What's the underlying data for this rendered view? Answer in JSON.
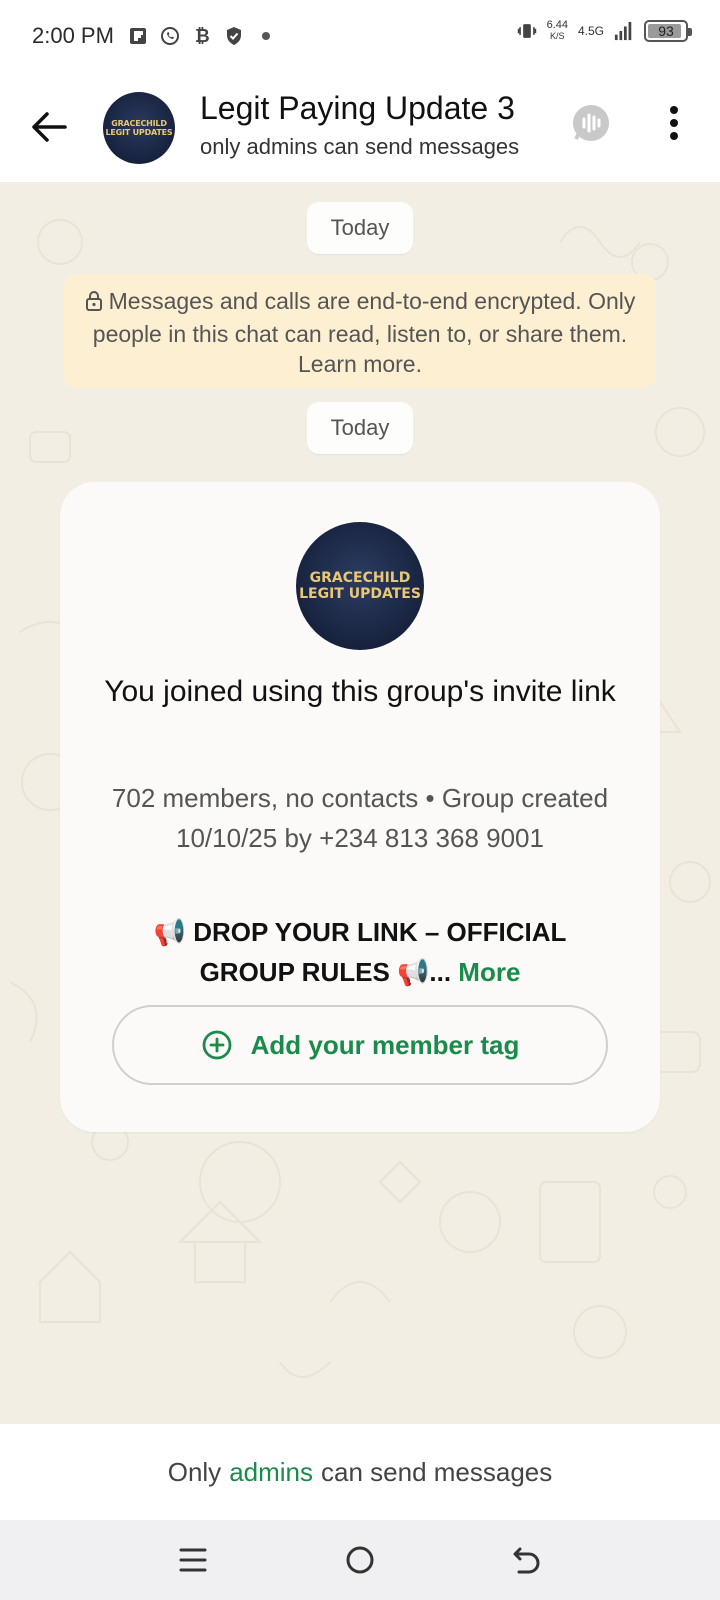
{
  "status_bar": {
    "time": "2:00 PM",
    "net_speed_value": "6.44",
    "net_speed_unit": "K/S",
    "network_type": "4.5G",
    "battery": "93",
    "left_icons": [
      "flipboard-icon",
      "whatsapp-icon",
      "bitcoin-icon",
      "shield-icon",
      "dot-icon"
    ]
  },
  "header": {
    "title": "Legit Paying Update 3",
    "subtitle": "only admins can send messages",
    "avatar_line1": "GRACECHILD",
    "avatar_line2": "LEGIT UPDATES"
  },
  "chat": {
    "date_label_1": "Today",
    "encryption_notice": "Messages and calls are end-to-end encrypted. Only people in this chat can read, listen to, or share them. Learn more.",
    "date_label_2": "Today",
    "card": {
      "avatar_line1": "GRACECHILD",
      "avatar_line2": "LEGIT UPDATES",
      "title": "You joined using this group's invite link",
      "meta": "702 members, no contacts • Group created 10/10/25 by +234 813 368 9001",
      "description": "📢 DROP YOUR LINK – OFFICIAL GROUP RULES 📢...",
      "more_label": "More",
      "member_tag_label": "Add your member tag"
    }
  },
  "footer": {
    "prefix": "Only",
    "link": "admins",
    "suffix": "can send messages"
  },
  "colors": {
    "accent_green": "#1b8a4b",
    "chat_bg": "#f3eee4",
    "encryption_bg": "#fdf0d2"
  }
}
